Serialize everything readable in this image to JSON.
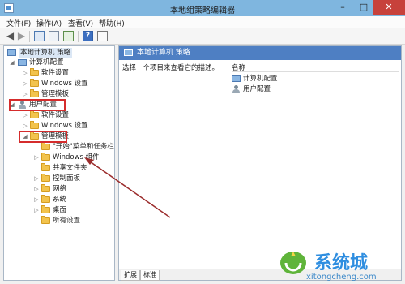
{
  "window": {
    "title": "本地组策略编辑器",
    "controls": {
      "minimize": "–",
      "maximize": "□",
      "close": "✕"
    }
  },
  "menu": [
    "文件(F)",
    "操作(A)",
    "查看(V)",
    "帮助(H)"
  ],
  "tree": {
    "root": "本地计算机 策略",
    "computer_config": "计算机配置",
    "software": "软件设置",
    "windows_settings": "Windows 设置",
    "admin_templates": "管理模板",
    "user_config": "用户配置",
    "u_software": "软件设置",
    "u_windows": "Windows 设置",
    "u_admin": "管理模板",
    "u_start": "\"开始\"菜单和任务栏",
    "u_wincomp": "Windows 组件",
    "u_shared": "共享文件夹",
    "u_control": "控制面板",
    "u_network": "网络",
    "u_system": "系统",
    "u_desktop": "桌面",
    "u_all": "所有设置"
  },
  "details": {
    "header": "本地计算机 策略",
    "description": "选择一个项目来查看它的描述。",
    "column_name": "名称",
    "items": [
      "计算机配置",
      "用户配置"
    ]
  },
  "tabs": [
    "扩展",
    "标准"
  ],
  "watermark": {
    "brand": "系统城",
    "url": "xitongcheng.com"
  },
  "colors": {
    "highlight": "#d52c2c",
    "header_bg": "#4e7fc3",
    "titlebar": "#7fb6df"
  }
}
